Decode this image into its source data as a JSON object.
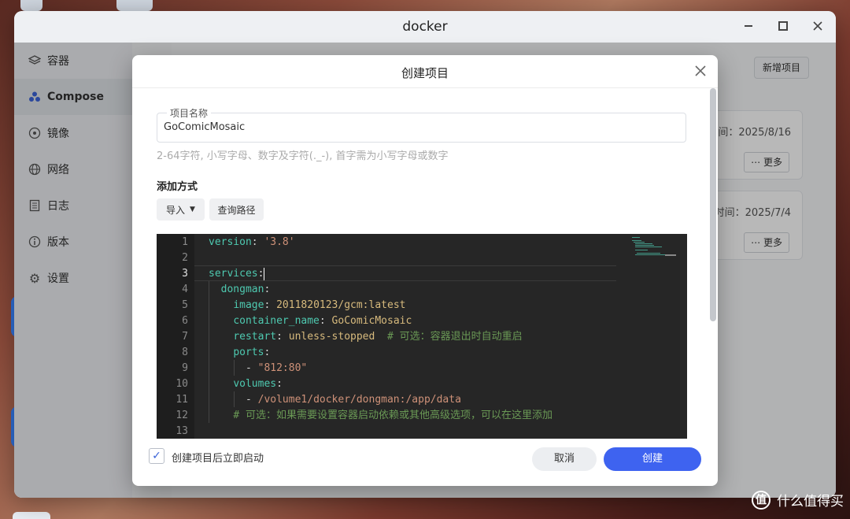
{
  "window": {
    "title": "docker"
  },
  "sidebar": {
    "items": [
      {
        "label": "容器",
        "icon": "layers-icon"
      },
      {
        "label": "Compose",
        "icon": "compose-icon",
        "active": true
      },
      {
        "label": "镜像",
        "icon": "image-disc-icon"
      },
      {
        "label": "网络",
        "icon": "globe-icon"
      },
      {
        "label": "日志",
        "icon": "log-icon"
      },
      {
        "label": "版本",
        "icon": "info-icon"
      },
      {
        "label": "设置",
        "icon": "gear-icon"
      }
    ]
  },
  "content": {
    "add_project": "新增项目",
    "cards": [
      {
        "time": "间：2025/8/16",
        "more": "更多"
      },
      {
        "time": "时间：2025/7/4",
        "more": "更多"
      }
    ]
  },
  "dialog": {
    "title": "创建项目",
    "name_label": "项目名称",
    "name_value": "GoComicMosaic",
    "hint": "2-64字符, 小写字母、数字及字符(._-), 首字需为小写字母或数字",
    "add_method_label": "添加方式",
    "import_label": "导入",
    "query_path_label": "查询路径",
    "code_lines": [
      {
        "n": "1",
        "parts": [
          [
            "key",
            "version"
          ],
          [
            "punc",
            ": "
          ],
          [
            "str",
            "'3.8'"
          ]
        ]
      },
      {
        "n": "2",
        "parts": []
      },
      {
        "n": "3",
        "parts": [
          [
            "key",
            "services"
          ],
          [
            "punc",
            ":"
          ]
        ]
      },
      {
        "n": "4",
        "parts": [
          [
            "punc",
            "  "
          ],
          [
            "key",
            "dongman"
          ],
          [
            "punc",
            ":"
          ]
        ]
      },
      {
        "n": "5",
        "parts": [
          [
            "punc",
            "    "
          ],
          [
            "key",
            "image"
          ],
          [
            "punc",
            ": "
          ],
          [
            "val",
            "2011820123/gcm:latest"
          ]
        ]
      },
      {
        "n": "6",
        "parts": [
          [
            "punc",
            "    "
          ],
          [
            "key",
            "container_name"
          ],
          [
            "punc",
            ": "
          ],
          [
            "val",
            "GoComicMosaic"
          ]
        ]
      },
      {
        "n": "7",
        "parts": [
          [
            "punc",
            "    "
          ],
          [
            "key",
            "restart"
          ],
          [
            "punc",
            ": "
          ],
          [
            "val",
            "unless-stopped"
          ],
          [
            "cm",
            "  # 可选：容器退出时自动重启"
          ]
        ]
      },
      {
        "n": "8",
        "parts": [
          [
            "punc",
            "    "
          ],
          [
            "key",
            "ports"
          ],
          [
            "punc",
            ":"
          ]
        ]
      },
      {
        "n": "9",
        "parts": [
          [
            "punc",
            "      - "
          ],
          [
            "str",
            "\"812:80\""
          ]
        ]
      },
      {
        "n": "10",
        "parts": [
          [
            "punc",
            "    "
          ],
          [
            "key",
            "volumes"
          ],
          [
            "punc",
            ":"
          ]
        ]
      },
      {
        "n": "11",
        "parts": [
          [
            "punc",
            "      - "
          ],
          [
            "str",
            "/volume1/docker/dongman:/app/data"
          ]
        ]
      },
      {
        "n": "12",
        "parts": [
          [
            "punc",
            "    "
          ],
          [
            "cm",
            "# 可选：如果需要设置容器启动依赖或其他高级选项，可以在这里添加"
          ]
        ]
      },
      {
        "n": "13",
        "parts": []
      }
    ],
    "current_line": "3",
    "auto_start_label": "创建项目后立即启动",
    "auto_start_checked": true,
    "cancel_label": "取消",
    "create_label": "创建"
  },
  "watermark": {
    "text": "什么值得买",
    "logo": "值"
  },
  "colors": {
    "primary": "#3e63f0",
    "editor_bg": "#262626",
    "key": "#4ec9b0",
    "string": "#ce9178",
    "comment": "#6a9955"
  }
}
